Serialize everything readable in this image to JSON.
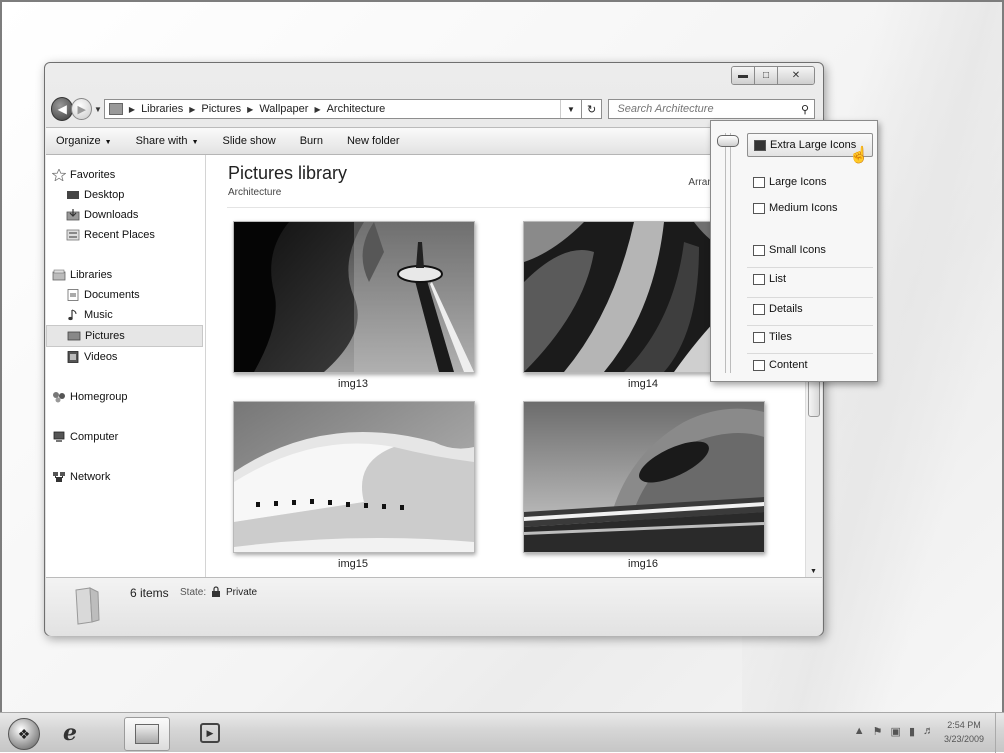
{
  "window": {
    "breadcrumb": [
      "Libraries",
      "Pictures",
      "Wallpaper",
      "Architecture"
    ],
    "search_placeholder": "Search Architecture",
    "toolbar": {
      "organize": "Organize",
      "share_with": "Share with",
      "slide_show": "Slide show",
      "burn": "Burn",
      "new_folder": "New folder"
    },
    "nav": {
      "favorites": "Favorites",
      "desktop": "Desktop",
      "downloads": "Downloads",
      "recent_places": "Recent Places",
      "libraries": "Libraries",
      "documents": "Documents",
      "music": "Music",
      "pictures": "Pictures",
      "videos": "Videos",
      "homegroup": "Homegroup",
      "computer": "Computer",
      "network": "Network"
    },
    "library": {
      "title": "Pictures library",
      "subtitle": "Architecture",
      "arrange_by": "Arrange"
    },
    "items": [
      {
        "name": "img13"
      },
      {
        "name": "img14"
      },
      {
        "name": "img15"
      },
      {
        "name": "img16"
      }
    ],
    "details": {
      "count": "6 items",
      "state_label": "State:",
      "state_value": "Private"
    }
  },
  "view_menu": {
    "items": [
      {
        "label": "Extra Large Icons",
        "selected": true
      },
      {
        "label": "Large Icons"
      },
      {
        "label": "Medium Icons"
      },
      {
        "label": "Small Icons"
      },
      {
        "label": "List"
      },
      {
        "label": "Details"
      },
      {
        "label": "Tiles"
      },
      {
        "label": "Content"
      }
    ]
  },
  "taskbar": {
    "time": "2:54 PM",
    "date": "3/23/2009"
  }
}
